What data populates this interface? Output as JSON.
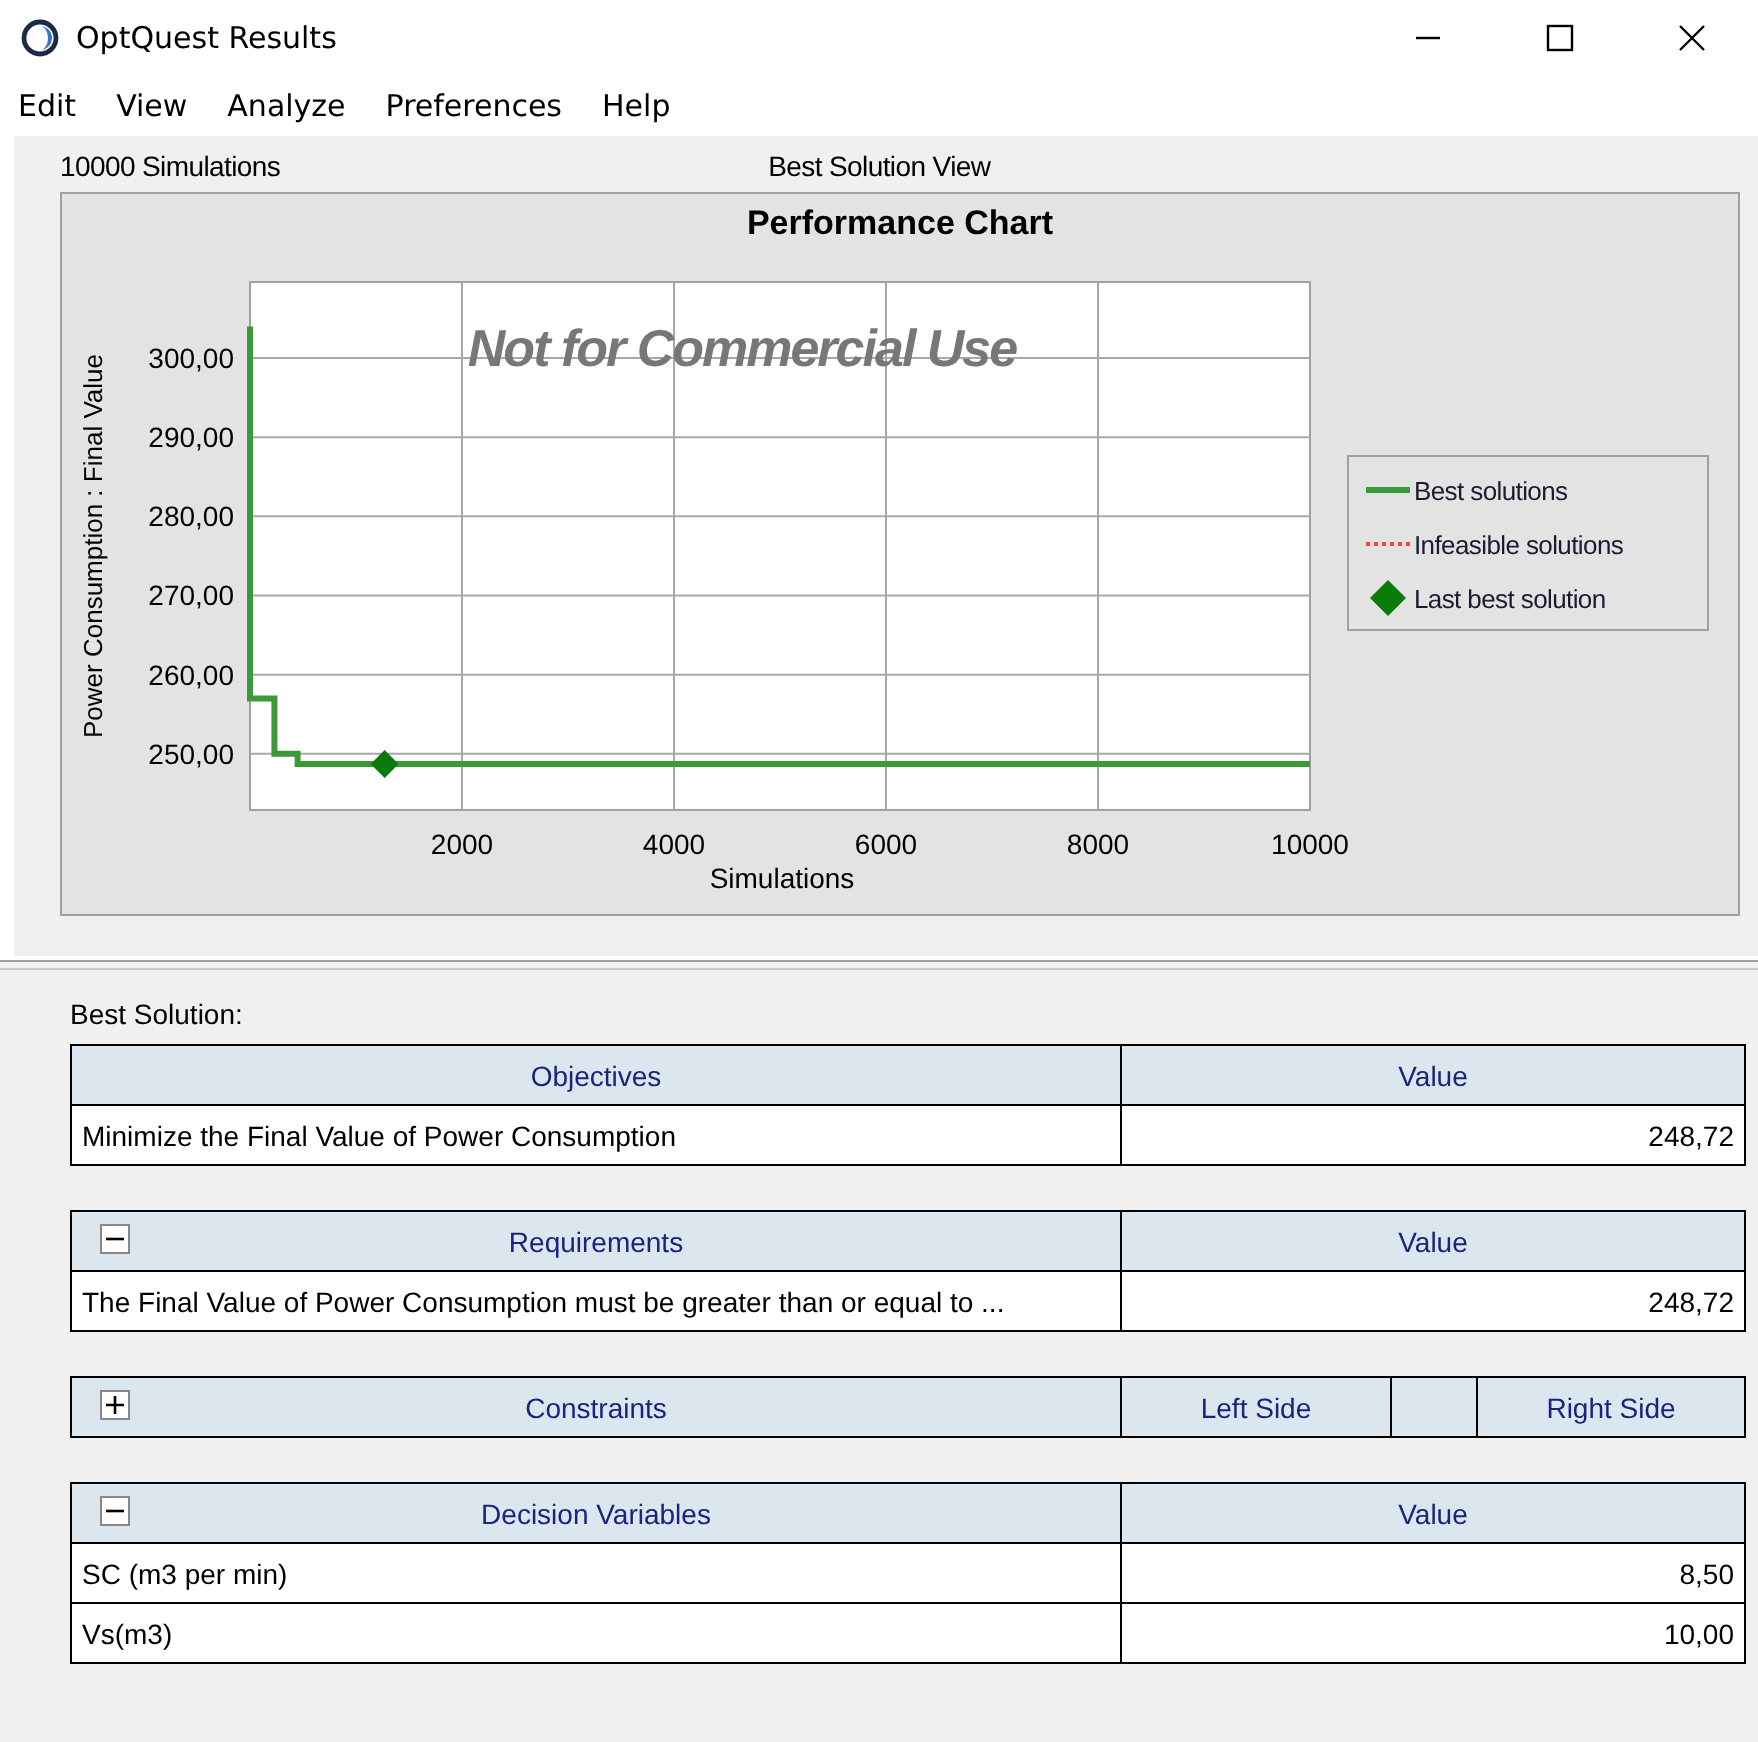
{
  "window": {
    "title": "OptQuest Results"
  },
  "menu": [
    "Edit",
    "View",
    "Analyze",
    "Preferences",
    "Help"
  ],
  "header": {
    "simulations": "10000 Simulations",
    "view": "Best Solution View"
  },
  "chart": {
    "chart_data": {
      "type": "line",
      "title": "Performance Chart",
      "xlabel": "Simulations",
      "ylabel": "Power Consumption : Final Value",
      "x": [
        0,
        0,
        230,
        230,
        450,
        450,
        1270,
        10000
      ],
      "xlim": [
        0,
        10000
      ],
      "ylim": [
        242.9,
        309.6
      ],
      "grid": true,
      "legend": true,
      "xticks": [
        2000,
        4000,
        6000,
        8000,
        10000
      ],
      "yticks": [
        {
          "value": 250,
          "label": "250,00"
        },
        {
          "value": 260,
          "label": "260,00"
        },
        {
          "value": 270,
          "label": "270,00"
        },
        {
          "value": 280,
          "label": "280,00"
        },
        {
          "value": 290,
          "label": "290,00"
        },
        {
          "value": 300,
          "label": "300,00"
        }
      ],
      "series": [
        {
          "name": "Best solutions",
          "color": "#3a9a3a",
          "values": [
            304,
            257,
            257,
            250,
            250,
            248.7,
            248.7,
            248.7
          ]
        },
        {
          "name": "Infeasible solutions",
          "color": "#ff4040",
          "values": [
            null,
            null,
            null,
            null,
            null,
            null,
            null,
            null
          ]
        },
        {
          "name": "Last best solution",
          "color": "#0a7a0a",
          "marker": "diamond",
          "values": [
            null,
            null,
            null,
            null,
            null,
            null,
            248.7,
            null
          ]
        }
      ],
      "annotations": [
        "Not for Commercial Use"
      ]
    }
  },
  "best_solution_label": "Best Solution:",
  "sections": [
    {
      "columns": [
        "Objectives",
        "Value"
      ],
      "rows": [
        [
          "Minimize the Final Value of Power Consumption",
          "248,72"
        ]
      ]
    },
    {
      "expanded": true,
      "columns": [
        "Requirements",
        "Value"
      ],
      "rows": [
        [
          "The Final Value of Power Consumption must be greater than or equal to ...",
          "248,72"
        ]
      ]
    },
    {
      "expanded": false,
      "columns": [
        "Constraints",
        "Left Side",
        "",
        "Right Side"
      ]
    },
    {
      "expanded": true,
      "columns": [
        "Decision Variables",
        "Value"
      ],
      "rows": [
        [
          "SC (m3 per min)",
          "8,50"
        ],
        [
          "Vs(m3)",
          "10,00"
        ]
      ]
    }
  ]
}
